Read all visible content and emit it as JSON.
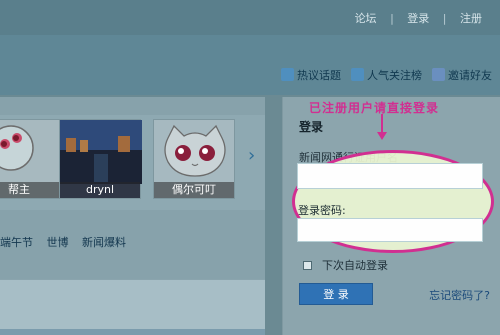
{
  "topnav": {
    "items": [
      "论坛",
      "登录",
      "注册"
    ],
    "separator": "|"
  },
  "links": [
    {
      "label": "热议话题",
      "icon": "home-icon",
      "color": "#4f8fbf"
    },
    {
      "label": "人气关注榜",
      "icon": "chart-icon",
      "color": "#4f8fbf"
    },
    {
      "label": "邀请好友",
      "icon": "user-icon",
      "color": "#6a8fbf"
    }
  ],
  "carousel": {
    "thumbs": [
      {
        "caption": "帮主"
      },
      {
        "caption": "drynl"
      },
      {
        "caption": "偶尔可叮"
      }
    ],
    "next_icon": "chevron-right-icon"
  },
  "tags": [
    "端午节",
    "世博",
    "新闻爆料"
  ],
  "login": {
    "title": "登录",
    "username_label": "新闻网通行证用户名",
    "password_label": "登录密码:",
    "remember_label": "下次自动登录",
    "submit_label": "登 录",
    "forgot_label": "忘记密码了?",
    "hint": "已注册用户请直接登录"
  },
  "colors": {
    "accent": "#d12f91",
    "button": "#2f72b5"
  }
}
